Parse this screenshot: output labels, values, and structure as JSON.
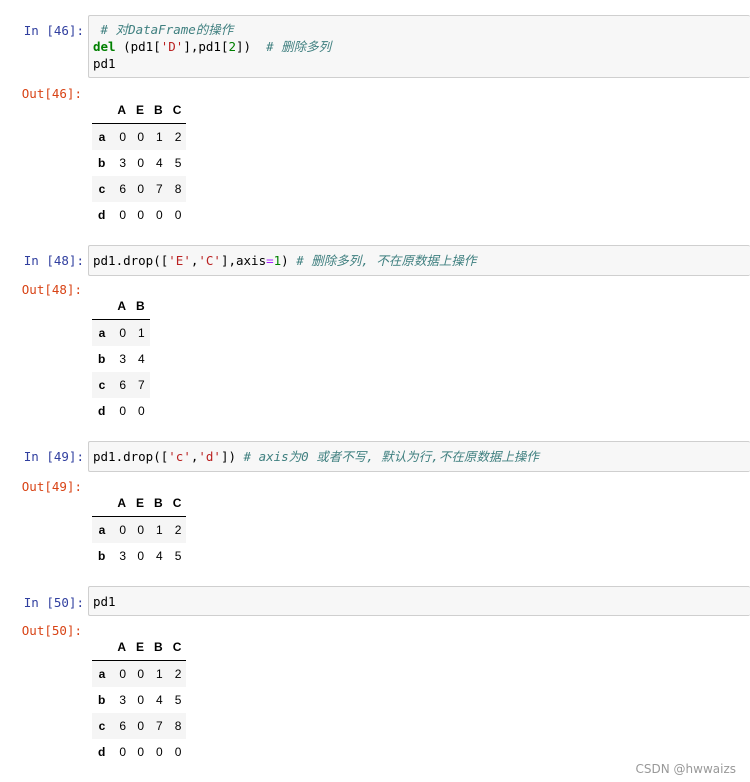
{
  "cells": [
    {
      "in_prompt": "In  [46]:",
      "out_prompt": "Out[46]:",
      "code": {
        "line1_comment": " # 对DataFrame的操作",
        "line2_kw": "del",
        "line2_a": " (pd1[",
        "line2_str": "'D'",
        "line2_b": "],pd1[",
        "line2_num": "2",
        "line2_c": "])  ",
        "line2_comment": "# 删除多列",
        "line3": "pd1"
      },
      "table": {
        "columns": [
          "A",
          "E",
          "B",
          "C"
        ],
        "rows": [
          {
            "index": "a",
            "values": [
              "0",
              "0",
              "1",
              "2"
            ]
          },
          {
            "index": "b",
            "values": [
              "3",
              "0",
              "4",
              "5"
            ]
          },
          {
            "index": "c",
            "values": [
              "6",
              "0",
              "7",
              "8"
            ]
          },
          {
            "index": "d",
            "values": [
              "0",
              "0",
              "0",
              "0"
            ]
          }
        ]
      }
    },
    {
      "in_prompt": "In  [48]:",
      "out_prompt": "Out[48]:",
      "code": {
        "a": "pd1.drop([",
        "str1": "'E'",
        "comma": ",",
        "str2": "'C'",
        "b": "],axis",
        "eq": "=",
        "num": "1",
        "c": ") ",
        "comment": "# 删除多列, 不在原数据上操作"
      },
      "table": {
        "columns": [
          "A",
          "B"
        ],
        "rows": [
          {
            "index": "a",
            "values": [
              "0",
              "1"
            ]
          },
          {
            "index": "b",
            "values": [
              "3",
              "4"
            ]
          },
          {
            "index": "c",
            "values": [
              "6",
              "7"
            ]
          },
          {
            "index": "d",
            "values": [
              "0",
              "0"
            ]
          }
        ]
      }
    },
    {
      "in_prompt": "In  [49]:",
      "out_prompt": "Out[49]:",
      "code": {
        "a": "pd1.drop([",
        "str1": "'c'",
        "comma": ",",
        "str2": "'d'",
        "b": "]) ",
        "comment": "# axis为0 或者不写, 默认为行,不在原数据上操作"
      },
      "table": {
        "columns": [
          "A",
          "E",
          "B",
          "C"
        ],
        "rows": [
          {
            "index": "a",
            "values": [
              "0",
              "0",
              "1",
              "2"
            ]
          },
          {
            "index": "b",
            "values": [
              "3",
              "0",
              "4",
              "5"
            ]
          }
        ]
      }
    },
    {
      "in_prompt": "In  [50]:",
      "out_prompt": "Out[50]:",
      "code": {
        "a": "pd1"
      },
      "table": {
        "columns": [
          "A",
          "E",
          "B",
          "C"
        ],
        "rows": [
          {
            "index": "a",
            "values": [
              "0",
              "0",
              "1",
              "2"
            ]
          },
          {
            "index": "b",
            "values": [
              "3",
              "0",
              "4",
              "5"
            ]
          },
          {
            "index": "c",
            "values": [
              "6",
              "0",
              "7",
              "8"
            ]
          },
          {
            "index": "d",
            "values": [
              "0",
              "0",
              "0",
              "0"
            ]
          }
        ]
      }
    }
  ],
  "watermark": "CSDN @hwwaizs",
  "colors": {
    "in_prompt": "#303F9F",
    "out_prompt": "#D84315",
    "keyword": "#008000",
    "string": "#BA2121",
    "comment": "#408080",
    "code_bg": "#f7f7f7"
  }
}
